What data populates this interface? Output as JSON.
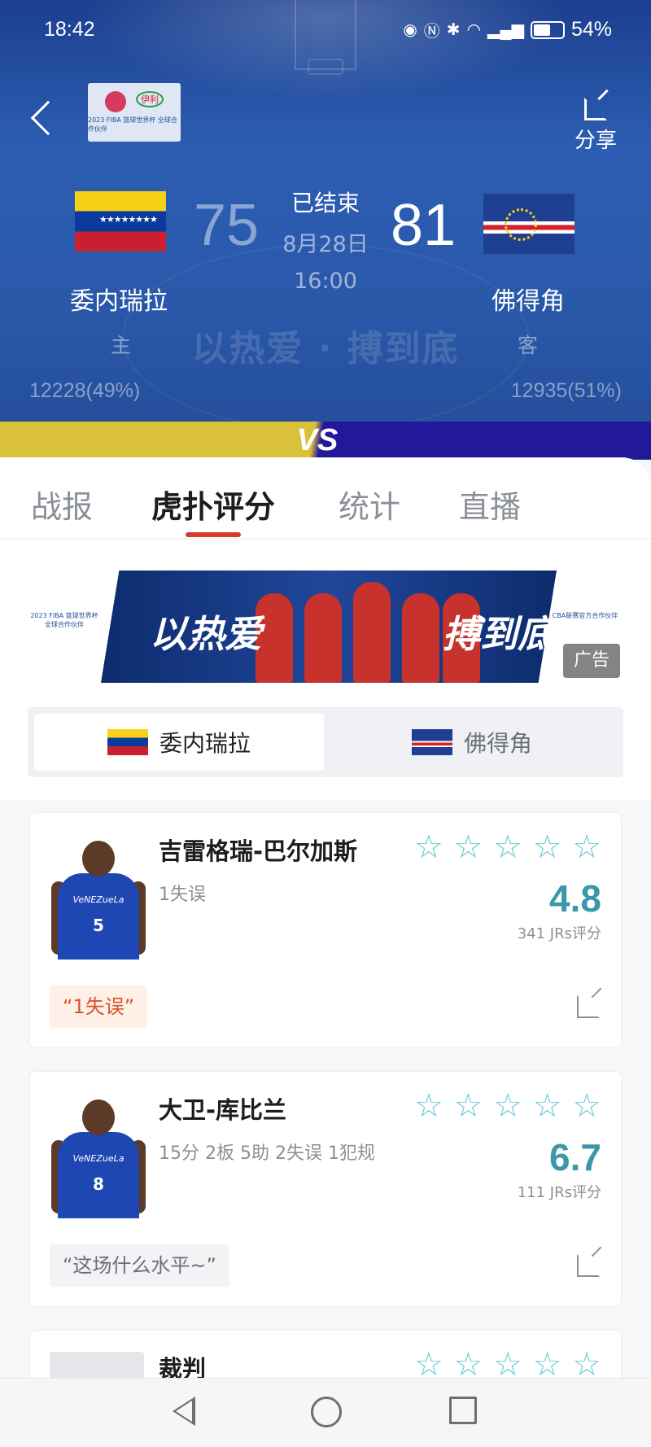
{
  "status_bar": {
    "time": "18:42",
    "battery": "54%"
  },
  "header": {
    "share_label": "分享",
    "match_state": "已结束",
    "match_date": "8月28日",
    "match_time": "16:00",
    "slogan_left": "以热爱",
    "slogan_sep": "·",
    "slogan_right": "搏到底",
    "home": {
      "name": "委内瑞拉",
      "score": "75",
      "side": "主",
      "votes": "12228(49%)"
    },
    "away": {
      "name": "佛得角",
      "score": "81",
      "side": "客",
      "votes": "12935(51%)"
    },
    "vs": "VS",
    "logo_text": "2023 FIBA 篮球世界杯 全球合作伙伴",
    "logo_brand": "伊利"
  },
  "tabs": [
    {
      "label": "战报",
      "active": false
    },
    {
      "label": "虎扑评分",
      "active": true
    },
    {
      "label": "统计",
      "active": false
    },
    {
      "label": "直播",
      "active": false
    }
  ],
  "banner": {
    "left_text": "以热爱",
    "right_text": "搏到底",
    "ad_label": "广告",
    "left_logo": "2023 FIBA 篮球世界杯 全球合作伙伴",
    "right_logo": "CBA联赛官方合作伙伴"
  },
  "team_switch": {
    "left": "委内瑞拉",
    "right": "佛得角",
    "selected": "委内瑞拉"
  },
  "players": [
    {
      "name": "吉雷格瑞-巴尔加斯",
      "stats": "1失误",
      "rating": "4.8",
      "votes": "341 JRs评分",
      "quote": "“1失误”",
      "number": "5",
      "jersey_text": "VeNEZueLa"
    },
    {
      "name": "大卫-库比兰",
      "stats": "15分 2板 5助 2失误 1犯规",
      "rating": "6.7",
      "votes": "111 JRs评分",
      "quote": "“这场什么水平~”",
      "number": "8",
      "jersey_text": "VeNEZueLa"
    },
    {
      "name": "裁判"
    }
  ],
  "colors": {
    "accent": "#d63a2f",
    "rating": "#3c98a8",
    "star": "#6dc9d6",
    "header_bg": "#2b5aac"
  },
  "icons": [
    "eye-icon",
    "nfc-icon",
    "bluetooth-icon",
    "wifi-icon",
    "signal-icon",
    "battery-icon",
    "back-icon",
    "share-icon",
    "star-icon",
    "external-link-icon"
  ]
}
